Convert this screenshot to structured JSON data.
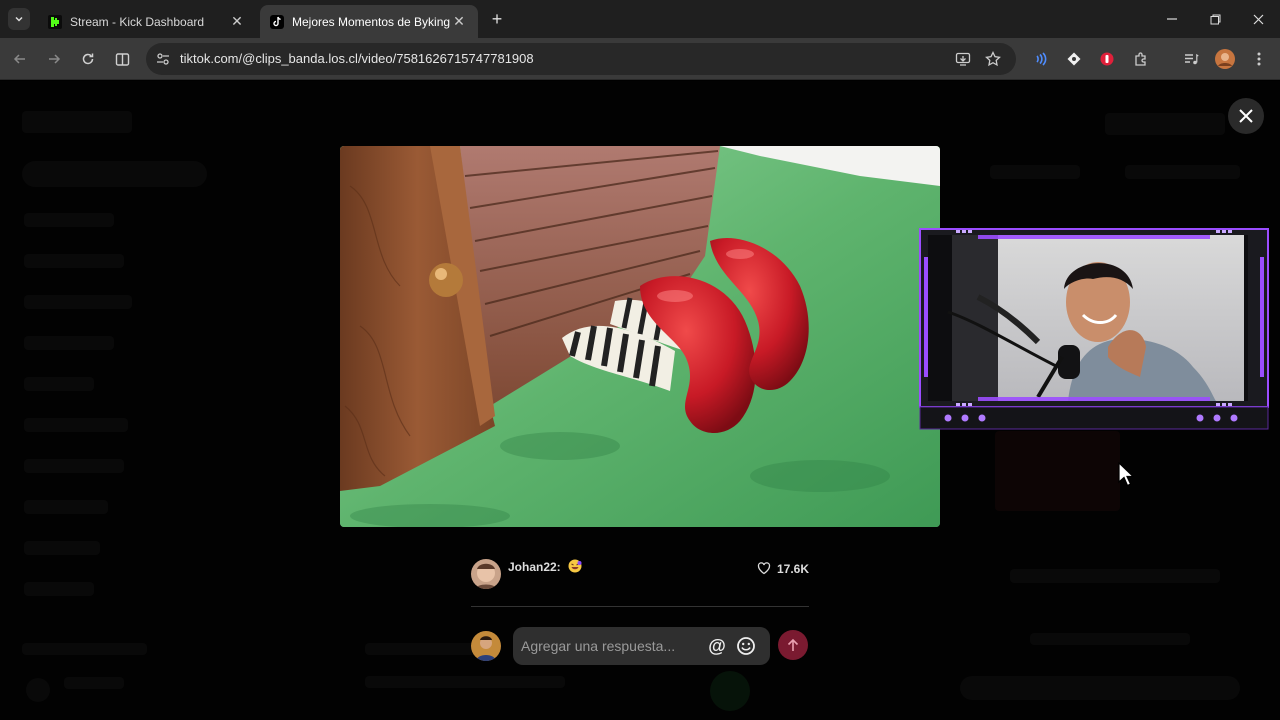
{
  "browser": {
    "tabs": [
      {
        "title": "Stream - Kick Dashboard",
        "favicon": "kick-icon",
        "active": false
      },
      {
        "title": "Mejores Momentos de Byking:",
        "favicon": "tiktok-icon",
        "active": true
      }
    ],
    "new_tab_label": "+",
    "url": "tiktok.com/@clips_banda.los.cl/video/7581626715747781908"
  },
  "comment": {
    "author": "Johan22:",
    "likes": "17.6K"
  },
  "reply": {
    "placeholder": "Agregar una respuesta...",
    "mention_symbol": "@"
  },
  "colors": {
    "tiktok_accent": "#fe2c55",
    "webcam_frame": "#9b4dff",
    "kick_green": "#53fc18"
  }
}
